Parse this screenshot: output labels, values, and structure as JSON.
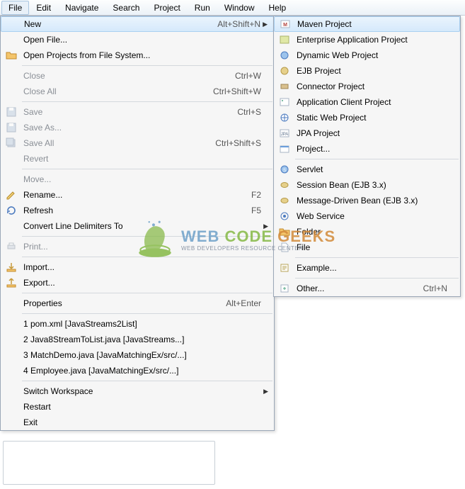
{
  "menubar": [
    "File",
    "Edit",
    "Navigate",
    "Search",
    "Project",
    "Run",
    "Window",
    "Help"
  ],
  "fileMenu": [
    {
      "label": "New",
      "shortcut": "Alt+Shift+N",
      "arrow": true,
      "highlight": true,
      "icon": "",
      "group": 0
    },
    {
      "label": "Open File...",
      "icon": "",
      "group": 0
    },
    {
      "label": "Open Projects from File System...",
      "icon": "folder-open",
      "group": 0
    },
    {
      "label": "Close",
      "shortcut": "Ctrl+W",
      "disabled": true,
      "group": 1
    },
    {
      "label": "Close All",
      "shortcut": "Ctrl+Shift+W",
      "disabled": true,
      "group": 1
    },
    {
      "label": "Save",
      "shortcut": "Ctrl+S",
      "disabled": true,
      "icon": "save",
      "group": 2
    },
    {
      "label": "Save As...",
      "disabled": true,
      "icon": "save",
      "group": 2
    },
    {
      "label": "Save All",
      "shortcut": "Ctrl+Shift+S",
      "disabled": true,
      "icon": "save-all",
      "group": 2
    },
    {
      "label": "Revert",
      "disabled": true,
      "group": 2
    },
    {
      "label": "Move...",
      "disabled": true,
      "group": 3
    },
    {
      "label": "Rename...",
      "shortcut": "F2",
      "icon": "rename",
      "group": 3
    },
    {
      "label": "Refresh",
      "shortcut": "F5",
      "icon": "refresh",
      "group": 3
    },
    {
      "label": "Convert Line Delimiters To",
      "arrow": true,
      "group": 3
    },
    {
      "label": "Print...",
      "disabled": true,
      "icon": "print",
      "group": 4
    },
    {
      "label": "Import...",
      "icon": "import",
      "group": 5
    },
    {
      "label": "Export...",
      "icon": "export",
      "group": 5
    },
    {
      "label": "Properties",
      "shortcut": "Alt+Enter",
      "group": 6
    },
    {
      "label": "1 pom.xml  [JavaStreams2List]",
      "group": 7
    },
    {
      "label": "2 Java8StreamToList.java  [JavaStreams...]",
      "group": 7
    },
    {
      "label": "3 MatchDemo.java  [JavaMatchingEx/src/...]",
      "group": 7
    },
    {
      "label": "4 Employee.java  [JavaMatchingEx/src/...]",
      "group": 7
    },
    {
      "label": "Switch Workspace",
      "arrow": true,
      "group": 8
    },
    {
      "label": "Restart",
      "group": 8
    },
    {
      "label": "Exit",
      "group": 8
    }
  ],
  "newMenu": [
    {
      "label": "Maven Project",
      "icon": "maven",
      "highlight": true,
      "group": 0
    },
    {
      "label": "Enterprise Application Project",
      "icon": "ear",
      "group": 0
    },
    {
      "label": "Dynamic Web Project",
      "icon": "dynweb",
      "group": 0
    },
    {
      "label": "EJB Project",
      "icon": "ejb",
      "group": 0
    },
    {
      "label": "Connector Project",
      "icon": "connector",
      "group": 0
    },
    {
      "label": "Application Client Project",
      "icon": "appclient",
      "group": 0
    },
    {
      "label": "Static Web Project",
      "icon": "staticweb",
      "group": 0
    },
    {
      "label": "JPA Project",
      "icon": "jpa",
      "group": 0
    },
    {
      "label": "Project...",
      "icon": "project",
      "group": 0
    },
    {
      "label": "Servlet",
      "icon": "servlet",
      "group": 1
    },
    {
      "label": "Session Bean (EJB 3.x)",
      "icon": "bean",
      "group": 1
    },
    {
      "label": "Message-Driven Bean (EJB 3.x)",
      "icon": "bean",
      "group": 1
    },
    {
      "label": "Web Service",
      "icon": "webservice",
      "group": 1
    },
    {
      "label": "Folder",
      "icon": "folder",
      "group": 1
    },
    {
      "label": "File",
      "icon": "file",
      "group": 1
    },
    {
      "label": "Example...",
      "icon": "example",
      "group": 2
    },
    {
      "label": "Other...",
      "shortcut": "Ctrl+N",
      "icon": "other",
      "group": 3
    }
  ],
  "watermark": {
    "main1": "WEB ",
    "main2": "CODE ",
    "main3": "GEEKS",
    "sub": "WEB DEVELOPERS RESOURCE CENTER"
  }
}
